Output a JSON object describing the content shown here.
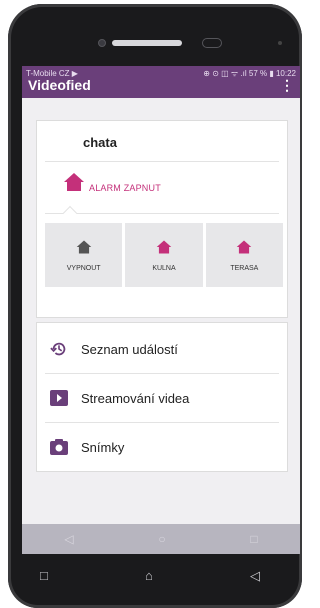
{
  "statusbar": {
    "carrier": "T-Mobile CZ ▶",
    "right": "⊕ ⊙ ◫ ᯤ .ıl 57 % ▮ 10:22"
  },
  "appbar": {
    "title": "Videofied",
    "more": "⋮"
  },
  "site": {
    "name": "chata"
  },
  "alarm": {
    "label": "ALARM ZAPNUT",
    "color": "#c4307a"
  },
  "zones": [
    {
      "label": "VYPNOUT",
      "icon": "home-icon",
      "color": "#555555"
    },
    {
      "label": "KULNA",
      "icon": "home-icon",
      "color": "#c4307a"
    },
    {
      "label": "TERASA",
      "icon": "home-icon",
      "color": "#c4307a"
    }
  ],
  "menu": [
    {
      "label": "Seznam událostí",
      "icon": "history-icon"
    },
    {
      "label": "Streamování videa",
      "icon": "video-play-icon"
    },
    {
      "label": "Snímky",
      "icon": "camera-icon"
    }
  ],
  "navbar": {
    "back": "◁",
    "home": "○",
    "recent": "□"
  },
  "hwkeys": {
    "recent": "□",
    "home": "⌂",
    "back": "◁"
  },
  "colors": {
    "primary": "#6a3f7a",
    "accent": "#c4307a"
  }
}
